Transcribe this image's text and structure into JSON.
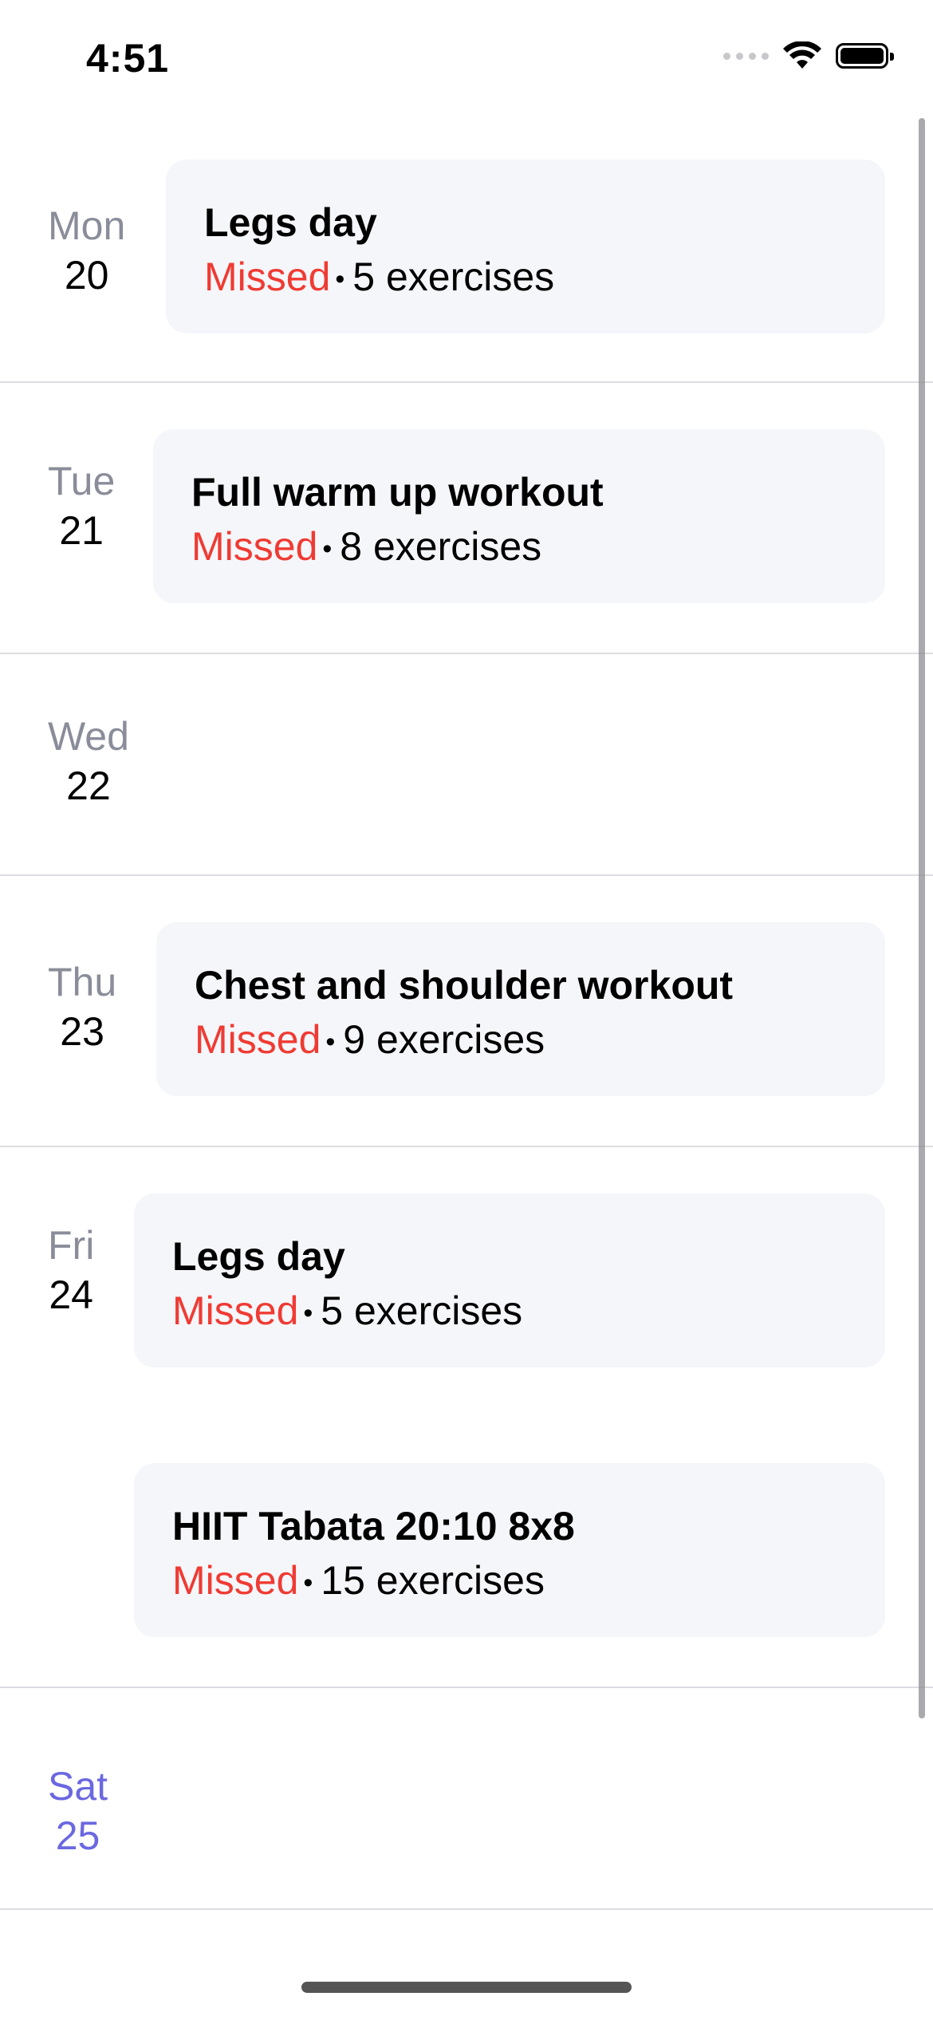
{
  "status_bar": {
    "time": "4:51",
    "icons": [
      "cellular-signal-icon",
      "wifi-icon",
      "battery-icon"
    ]
  },
  "days": [
    {
      "day": "Mon",
      "date": "20",
      "workouts": [
        {
          "title": "Legs day",
          "status": "Missed",
          "exercises": "5 exercises"
        }
      ]
    },
    {
      "day": "Tue",
      "date": "21",
      "workouts": [
        {
          "title": "Full warm up workout",
          "status": "Missed",
          "exercises": "8 exercises"
        }
      ]
    },
    {
      "day": "Wed",
      "date": "22",
      "workouts": []
    },
    {
      "day": "Thu",
      "date": "23",
      "workouts": [
        {
          "title": "Chest and shoulder workout",
          "status": "Missed",
          "exercises": "9 exercises"
        }
      ]
    },
    {
      "day": "Fri",
      "date": "24",
      "workouts": [
        {
          "title": "Legs day",
          "status": "Missed",
          "exercises": "5 exercises"
        },
        {
          "title": "HIIT Tabata 20:10 8x8",
          "status": "Missed",
          "exercises": "15 exercises"
        }
      ]
    },
    {
      "day": "Sat",
      "date": "25",
      "workouts": [],
      "is_today": true
    }
  ],
  "separator": "•",
  "colors": {
    "missed": "#ef3b33",
    "today_accent": "#6b68e0",
    "day_name": "#8a8d99",
    "card_bg": "#f5f6fa"
  }
}
